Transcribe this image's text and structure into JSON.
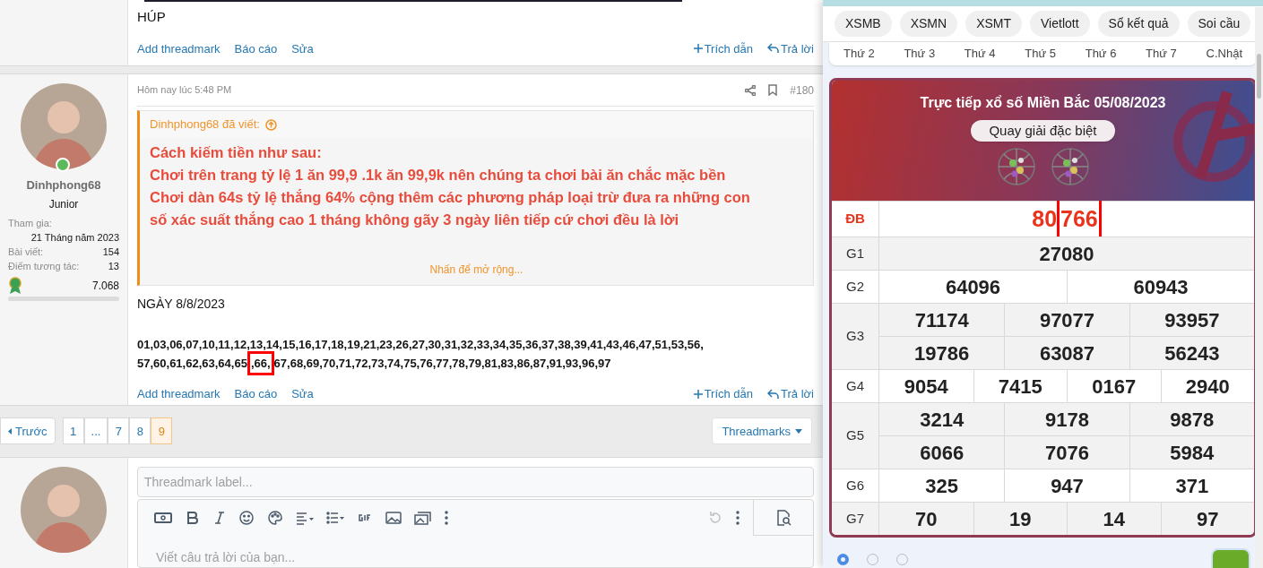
{
  "forum": {
    "top_post": {
      "text": "HÚP",
      "actions_left": [
        "Add threadmark",
        "Báo cáo",
        "Sửa"
      ],
      "quote_action": "Trích dẫn",
      "reply_action": "Trả lời"
    },
    "post": {
      "time": "Hôm nay lúc 5:48 PM",
      "number": "#180",
      "author": {
        "name": "Dinhphong68",
        "role": "Junior",
        "joined_label": "Tham gia:",
        "joined": "21 Tháng năm 2023",
        "stats": [
          {
            "label": "Bài viết:",
            "value": "154"
          },
          {
            "label": "Điểm tương tác:",
            "value": "13"
          }
        ],
        "points": "7.068",
        "online": true
      },
      "quote": {
        "header": "Dinhphong68 đã viết:",
        "lines": [
          "Cách kiếm tiền như sau:",
          "Chơi trên trang tỷ lệ 1 ăn 99,9 .1k ăn 99,9k nên chúng ta chơi bài ăn chắc mặc bền",
          "Chơi dàn 64s tỷ lệ thắng 64% cộng thêm các phương pháp loại trừ đưa ra những con",
          "số xác suất thắng cao 1 tháng không gãy 3 ngày liên tiếp cứ chơi đều là lời"
        ],
        "expand": "Nhấn để mở rộng..."
      },
      "heading": "NGÀY 8/8/2023",
      "number_lines": [
        [
          {
            "text": "01,03,06,07,10,11,12,13,14,15,16,17,18,19,21,23,26,27,30,31,32,33,34,35,36,37,38,39,41,43,46,47,51,53,56,",
            "highlighted": false
          }
        ],
        [
          {
            "text": "57,60,61,62,63,64,65",
            "highlighted": false
          },
          {
            "text": ",66,",
            "highlighted": true
          },
          {
            "text": "67,68,69,70,71,72,73,74,75,76,77,78,79,81,83,86,87,91,93,96,97",
            "highlighted": false
          }
        ]
      ],
      "actions_left": [
        "Add threadmark",
        "Báo cáo",
        "Sửa"
      ],
      "quote_action": "Trích dẫn",
      "reply_action": "Trả lời"
    },
    "pagination": {
      "prev": "Trước",
      "pages": [
        {
          "label": "1",
          "selected": false
        },
        {
          "label": "...",
          "selected": false
        },
        {
          "label": "7",
          "selected": false
        },
        {
          "label": "8",
          "selected": false
        },
        {
          "label": "9",
          "selected": true
        }
      ],
      "threadmarks": "Threadmarks"
    },
    "reply": {
      "label_placeholder": "Threadmark label...",
      "editor_placeholder": "Viết câu trả lời của bạn..."
    }
  },
  "lottery": {
    "nav": [
      "XSMB",
      "XSMN",
      "XSMT",
      "Vietlott",
      "Sổ kết quả",
      "Soi cầu"
    ],
    "days": [
      "Thứ 2",
      "Thứ 3",
      "Thứ 4",
      "Thứ 5",
      "Thứ 6",
      "Thứ 7",
      "C.Nhật"
    ],
    "title": "Trực tiếp xổ số Miền Bắc 05/08/2023",
    "spin_button": "Quay giải đặc biệt",
    "rows": [
      {
        "label": "ĐB",
        "kind": "special",
        "lines": [
          [
            [
              {
                "text": "80",
                "highlighted": false
              },
              {
                "text": "766",
                "highlighted": true
              }
            ]
          ]
        ]
      },
      {
        "label": "G1",
        "kind": "normal",
        "lines": [
          [
            "27080"
          ]
        ]
      },
      {
        "label": "G2",
        "kind": "normal",
        "lines": [
          [
            "64096",
            "60943"
          ]
        ]
      },
      {
        "label": "G3",
        "kind": "normal",
        "lines": [
          [
            "71174",
            "97077",
            "93957"
          ],
          [
            "19786",
            "63087",
            "56243"
          ]
        ]
      },
      {
        "label": "G4",
        "kind": "normal",
        "lines": [
          [
            "9054",
            "7415",
            "0167",
            "2940"
          ]
        ]
      },
      {
        "label": "G5",
        "kind": "normal",
        "lines": [
          [
            "3214",
            "9178",
            "9878"
          ],
          [
            "6066",
            "7076",
            "5984"
          ]
        ]
      },
      {
        "label": "G6",
        "kind": "normal",
        "lines": [
          [
            "325",
            "947",
            "371"
          ]
        ]
      },
      {
        "label": "G7",
        "kind": "normal",
        "lines": [
          [
            "70",
            "19",
            "14",
            "97"
          ]
        ]
      }
    ],
    "radio_options": [
      {
        "selected": true
      },
      {
        "selected": false
      },
      {
        "selected": false
      }
    ]
  }
}
